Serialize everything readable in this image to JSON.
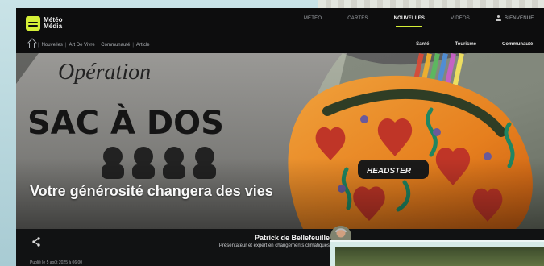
{
  "site": {
    "logo_text": "Météo Média",
    "brand_color": "#d5ef37"
  },
  "nav": {
    "items": [
      {
        "label": "MÉTÉO",
        "active": false
      },
      {
        "label": "CARTES",
        "active": false
      },
      {
        "label": "NOUVELLES",
        "active": true
      },
      {
        "label": "VIDÉOS",
        "active": false
      }
    ],
    "user_label": "Bienvenue"
  },
  "breadcrumb": {
    "items": [
      "Nouvelles",
      "Art De Vivre",
      "Communauté",
      "Article"
    ]
  },
  "subtabs": {
    "items": [
      "Santé",
      "Tourisme",
      "Communauté"
    ]
  },
  "hero": {
    "title": "Votre générosité changera des vies",
    "image_text": {
      "operation": "Opération",
      "sac": "SAC À DOS",
      "brand": "HEADSTER"
    }
  },
  "article": {
    "author_name": "Patrick de Bellefeuille",
    "author_role": "Présentateur et expert en changements climatiques",
    "published": "Publié le 5 août 2025 à 06:00"
  },
  "icons": {
    "share": "share-icon",
    "home": "home-icon",
    "user": "user-icon"
  }
}
